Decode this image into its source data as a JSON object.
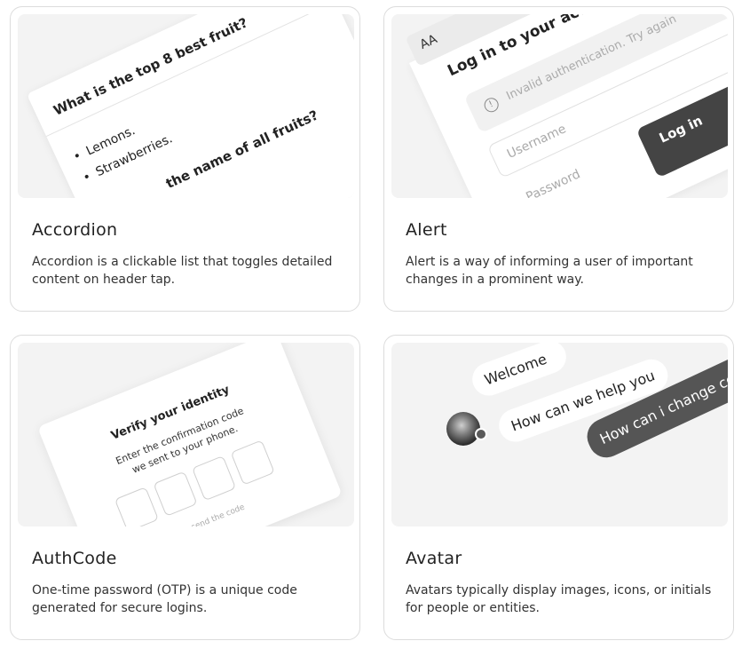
{
  "cards": [
    {
      "title": "Accordion",
      "description": "Accordion is a clickable list that toggles detailed content on header tap.",
      "preview": {
        "question_1": "What is the top 8 best fruit?",
        "items": [
          "Lemons.",
          "Strawberries."
        ],
        "question_2": "the name of all fruits?"
      }
    },
    {
      "title": "Alert",
      "description": "Alert is a way of informing a user of important changes in a prominent way.",
      "preview": {
        "font_toggle": "AA",
        "heading": "Log in to your account",
        "alert_text": "Invalid authentication. Try again",
        "alert_icon": "!",
        "username_placeholder": "Username",
        "password_placeholder": "Password",
        "button_label": "Log in"
      }
    },
    {
      "title": "AuthCode",
      "description": "One-time password (OTP) is a unique code generated for secure logins.",
      "preview": {
        "heading": "Verify your identity",
        "subtitle_line1": "Enter the confirmation code",
        "subtitle_line2": "we sent to your phone.",
        "resend": "Resend the code"
      }
    },
    {
      "title": "Avatar",
      "description": "Avatars typically display images, icons, or initials for people or entities.",
      "preview": {
        "bubble_1": "Welcome",
        "bubble_2": "How can we help you",
        "bubble_3": "How can i change color"
      }
    }
  ]
}
